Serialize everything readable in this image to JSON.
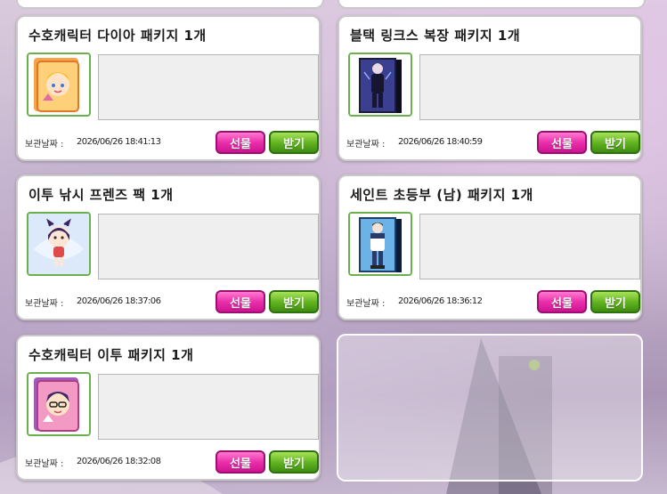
{
  "date_label": "보관날짜 :",
  "gift_label": "선물",
  "receive_label": "받기",
  "cards": [
    {
      "title": "수호캐릭터 다이아 패키지 1개",
      "date": "2026/06/26 18:41:13",
      "icon": "diamond-character-card-icon"
    },
    {
      "title": "블택 링크스 복장 패키지 1개",
      "date": "2026/06/26 18:40:59",
      "icon": "black-lynx-outfit-box-icon"
    },
    {
      "title": "이투 낚시 프렌즈 팩 1개",
      "date": "2026/06/26 18:37:06",
      "icon": "fishing-friends-character-icon"
    },
    {
      "title": "세인트 초등부 (남) 패키지 1개",
      "date": "2026/06/26 18:36:12",
      "icon": "saint-elementary-uniform-box-icon"
    },
    {
      "title": "수호캐릭터 이투 패키지 1개",
      "date": "2026/06/26 18:32:08",
      "icon": "itu-character-card-icon"
    }
  ],
  "colors": {
    "gift": "#e62ea8",
    "receive": "#5cb21c",
    "thumb_border": "#6ab04c"
  }
}
